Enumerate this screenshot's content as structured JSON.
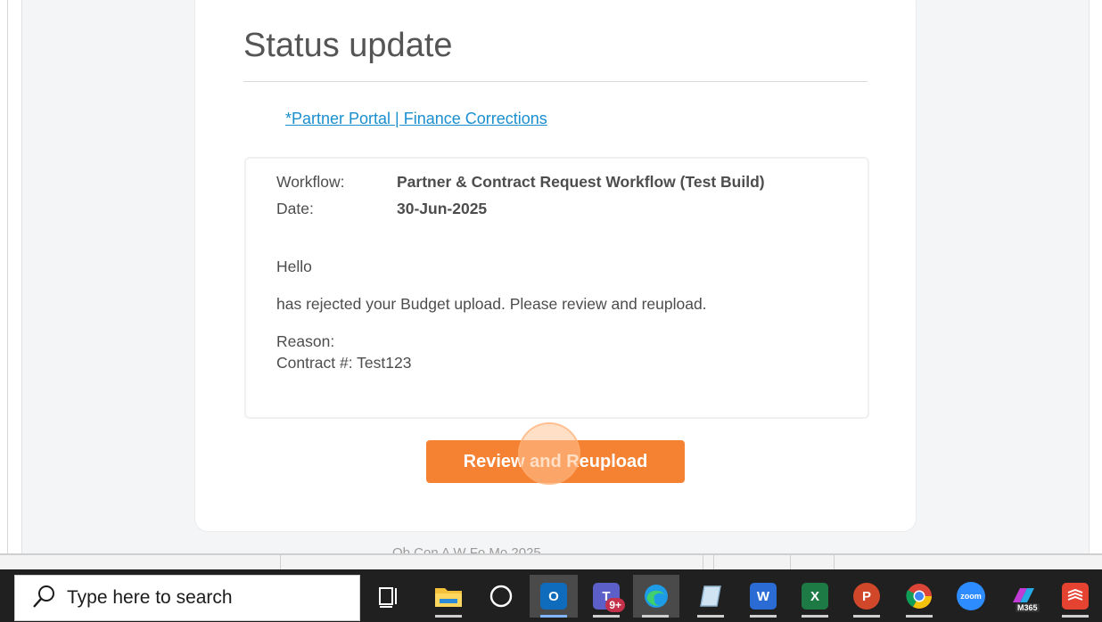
{
  "email": {
    "title": "Status update",
    "portal_link": "*Partner Portal | Finance Corrections",
    "workflow_label": "Workflow:",
    "workflow_value": "Partner & Contract Request Workflow (Test Build)",
    "date_label": "Date:",
    "date_value": "30-Jun-2025",
    "greeting": "Hello",
    "message": "has rejected your Budget upload. Please review and reupload.",
    "reason_label": "Reason:",
    "contract_line": "Contract #: Test123",
    "button_label": "Review and Reupload",
    "footer_partial": "Ob Con A W Fo Mo 2025"
  },
  "taskbar": {
    "search_placeholder": "Type here to search",
    "teams_badge": "9+",
    "zoom_label": "zoom",
    "m365_label": "M365",
    "outlook_letter": "O",
    "word_letter": "W",
    "excel_letter": "X",
    "powerpoint_letter": "P"
  },
  "colors": {
    "accent_orange": "#f58232",
    "link_blue": "#1a8fd0",
    "taskbar_bg": "#202020"
  }
}
